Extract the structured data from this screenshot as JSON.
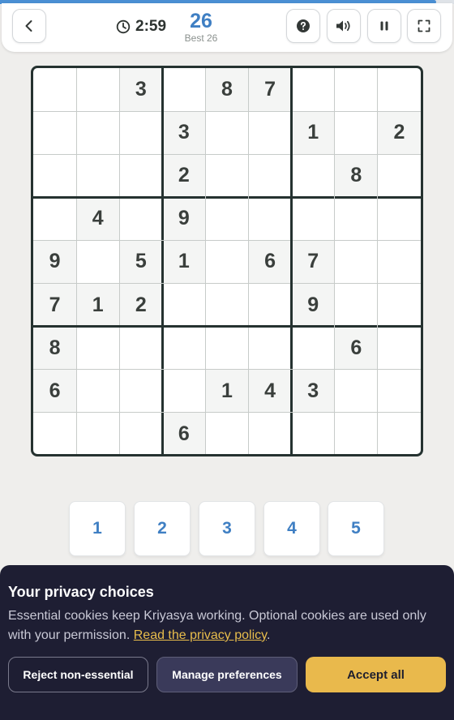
{
  "progress": {
    "fraction": 0.96,
    "color": "#4a8fd4"
  },
  "header": {
    "back_icon": "chevron-left-icon",
    "timer_icon": "clock-icon",
    "timer": "2:59",
    "score": "26",
    "best": "Best 26",
    "help_icon": "question-icon",
    "sound_icon": "speaker-icon",
    "pause_icon": "pause-icon",
    "fullscreen_icon": "fullscreen-icon"
  },
  "board": {
    "grid": [
      [
        "",
        "",
        "3",
        "",
        "8",
        "7",
        "",
        "",
        ""
      ],
      [
        "",
        "",
        "",
        "3",
        "",
        "",
        "1",
        "",
        "2"
      ],
      [
        "",
        "",
        "",
        "2",
        "",
        "",
        "",
        "8",
        ""
      ],
      [
        "",
        "4",
        "",
        "9",
        "",
        "",
        "",
        "",
        ""
      ],
      [
        "9",
        "",
        "5",
        "1",
        "",
        "6",
        "7",
        "",
        ""
      ],
      [
        "7",
        "1",
        "2",
        "",
        "",
        "",
        "9",
        "",
        ""
      ],
      [
        "8",
        "",
        "",
        "",
        "",
        "",
        "",
        "6",
        ""
      ],
      [
        "6",
        "",
        "",
        "",
        "1",
        "4",
        "3",
        "",
        ""
      ],
      [
        "",
        "",
        "",
        "6",
        "",
        "",
        "",
        "",
        ""
      ]
    ]
  },
  "numpad": [
    "1",
    "2",
    "3",
    "4",
    "5"
  ],
  "cookie": {
    "title": "Your privacy choices",
    "body": "Essential cookies keep Kriyasya working. Optional cookies are used only with your permission.",
    "link": "Read the privacy policy",
    "trailing": ".",
    "reject_label": "Reject non-essential",
    "manage_label": "Manage preferences",
    "accept_label": "Accept all"
  },
  "colors": {
    "accent": "#3f7fc3",
    "accept": "#e9b94c",
    "banner": "#1e1e33",
    "board_border": "#253230"
  }
}
